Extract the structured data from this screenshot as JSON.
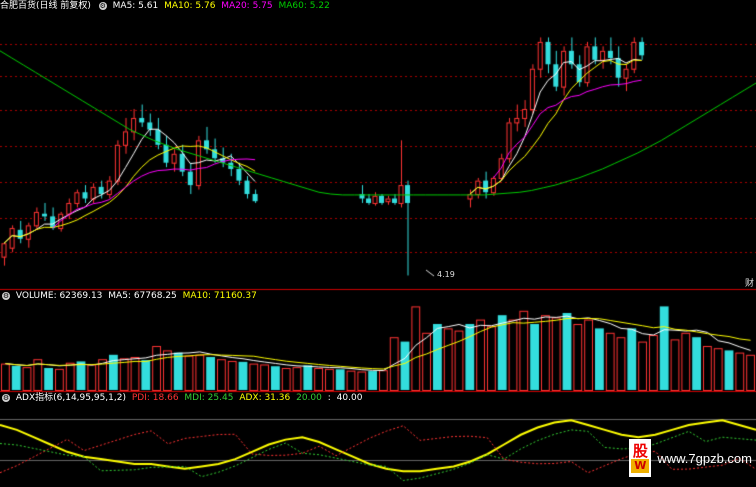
{
  "main_header": {
    "title": "合肥百货(日线 前复权)",
    "ma5": "MA5: 5.61",
    "ma10": "MA10: 5.76",
    "ma20": "MA20: 5.75",
    "ma60": "MA60: 5.22"
  },
  "volume_header": {
    "label": "VOLUME: 62369.13",
    "ma5": "MA5: 67768.25",
    "ma10": "MA10: 71160.37"
  },
  "adx_header": {
    "label": "ADX指标(6,14,95,95,1,2)",
    "pdi": "PDI: 18.66",
    "mdi": "MDI: 25.45",
    "adx": "ADX: 31.36",
    "level1": "20.00",
    "level2": "40.00"
  },
  "low_price_label": "4.19",
  "side_tag": "财",
  "watermark": {
    "logo_top": "股",
    "logo_bottom": "W",
    "site": "www.7gpzb.com"
  },
  "colors": {
    "up": "#ff3333",
    "down": "#33dddd",
    "ma5": "#ffffff",
    "ma10": "#ffff00",
    "ma20": "#ff00ff",
    "ma60": "#00cc00",
    "grid": "#aa0000",
    "adx": "#ffff00",
    "pdi": "#ff3333",
    "mdi": "#33cc33"
  },
  "chart_data": {
    "type": "candlestick",
    "y_scale": "price",
    "candles": [
      {
        "o": 4.4,
        "h": 4.55,
        "l": 4.3,
        "c": 4.55
      },
      {
        "o": 4.5,
        "h": 4.75,
        "l": 4.45,
        "c": 4.72
      },
      {
        "o": 4.7,
        "h": 4.8,
        "l": 4.55,
        "c": 4.6
      },
      {
        "o": 4.6,
        "h": 4.78,
        "l": 4.5,
        "c": 4.75
      },
      {
        "o": 4.75,
        "h": 4.95,
        "l": 4.7,
        "c": 4.9
      },
      {
        "o": 4.88,
        "h": 5.0,
        "l": 4.8,
        "c": 4.85
      },
      {
        "o": 4.85,
        "h": 4.95,
        "l": 4.7,
        "c": 4.72
      },
      {
        "o": 4.72,
        "h": 4.9,
        "l": 4.68,
        "c": 4.88
      },
      {
        "o": 4.88,
        "h": 5.05,
        "l": 4.82,
        "c": 5.0
      },
      {
        "o": 5.0,
        "h": 5.15,
        "l": 4.95,
        "c": 5.12
      },
      {
        "o": 5.12,
        "h": 5.2,
        "l": 5.0,
        "c": 5.05
      },
      {
        "o": 5.05,
        "h": 5.22,
        "l": 5.0,
        "c": 5.18
      },
      {
        "o": 5.18,
        "h": 5.25,
        "l": 5.05,
        "c": 5.1
      },
      {
        "o": 5.1,
        "h": 5.3,
        "l": 5.05,
        "c": 5.25
      },
      {
        "o": 5.25,
        "h": 5.7,
        "l": 5.2,
        "c": 5.65
      },
      {
        "o": 5.65,
        "h": 5.95,
        "l": 5.55,
        "c": 5.8
      },
      {
        "o": 5.8,
        "h": 6.05,
        "l": 5.7,
        "c": 5.95
      },
      {
        "o": 5.95,
        "h": 6.1,
        "l": 5.85,
        "c": 5.9
      },
      {
        "o": 5.9,
        "h": 6.0,
        "l": 5.75,
        "c": 5.82
      },
      {
        "o": 5.82,
        "h": 5.95,
        "l": 5.6,
        "c": 5.65
      },
      {
        "o": 5.65,
        "h": 5.75,
        "l": 5.4,
        "c": 5.45
      },
      {
        "o": 5.45,
        "h": 5.6,
        "l": 5.35,
        "c": 5.55
      },
      {
        "o": 5.55,
        "h": 5.65,
        "l": 5.3,
        "c": 5.35
      },
      {
        "o": 5.35,
        "h": 5.45,
        "l": 5.1,
        "c": 5.2
      },
      {
        "o": 5.2,
        "h": 5.75,
        "l": 5.15,
        "c": 5.7
      },
      {
        "o": 5.7,
        "h": 5.85,
        "l": 5.55,
        "c": 5.6
      },
      {
        "o": 5.6,
        "h": 5.72,
        "l": 5.45,
        "c": 5.5
      },
      {
        "o": 5.5,
        "h": 5.62,
        "l": 5.4,
        "c": 5.45
      },
      {
        "o": 5.45,
        "h": 5.55,
        "l": 5.3,
        "c": 5.38
      },
      {
        "o": 5.38,
        "h": 5.45,
        "l": 5.2,
        "c": 5.25
      },
      {
        "o": 5.25,
        "h": 5.3,
        "l": 5.05,
        "c": 5.1
      },
      {
        "o": 5.1,
        "h": 5.15,
        "l": 5.0,
        "c": 5.02
      }
    ],
    "late_candles": [
      {
        "o": 5.1,
        "h": 5.2,
        "l": 5.0,
        "c": 5.05
      },
      {
        "o": 5.05,
        "h": 5.1,
        "l": 4.98,
        "c": 5.0
      },
      {
        "o": 5.0,
        "h": 5.12,
        "l": 4.97,
        "c": 5.08
      },
      {
        "o": 5.08,
        "h": 5.1,
        "l": 4.98,
        "c": 5.0
      },
      {
        "o": 5.02,
        "h": 5.08,
        "l": 4.98,
        "c": 5.05
      },
      {
        "o": 5.05,
        "h": 5.1,
        "l": 4.98,
        "c": 5.0
      },
      {
        "o": 5.0,
        "h": 5.7,
        "l": 4.95,
        "c": 5.2
      },
      {
        "o": 5.2,
        "h": 5.25,
        "l": 4.19,
        "c": 5.0
      },
      {
        "o": 5.05,
        "h": 5.15,
        "l": 4.95,
        "c": 5.1
      },
      {
        "o": 5.1,
        "h": 5.28,
        "l": 5.05,
        "c": 5.25
      },
      {
        "o": 5.25,
        "h": 5.35,
        "l": 5.05,
        "c": 5.12
      },
      {
        "o": 5.12,
        "h": 5.3,
        "l": 5.08,
        "c": 5.28
      },
      {
        "o": 5.28,
        "h": 5.55,
        "l": 5.25,
        "c": 5.5
      },
      {
        "o": 5.5,
        "h": 5.95,
        "l": 5.45,
        "c": 5.9
      },
      {
        "o": 5.9,
        "h": 6.1,
        "l": 5.8,
        "c": 5.95
      },
      {
        "o": 5.95,
        "h": 6.15,
        "l": 5.85,
        "c": 6.05
      },
      {
        "o": 6.05,
        "h": 6.55,
        "l": 6.0,
        "c": 6.5
      },
      {
        "o": 6.5,
        "h": 6.85,
        "l": 6.4,
        "c": 6.8
      },
      {
        "o": 6.8,
        "h": 6.85,
        "l": 6.45,
        "c": 6.55
      },
      {
        "o": 6.55,
        "h": 6.7,
        "l": 6.25,
        "c": 6.3
      },
      {
        "o": 6.3,
        "h": 6.75,
        "l": 6.2,
        "c": 6.7
      },
      {
        "o": 6.7,
        "h": 6.85,
        "l": 6.5,
        "c": 6.55
      },
      {
        "o": 6.55,
        "h": 6.65,
        "l": 6.3,
        "c": 6.35
      },
      {
        "o": 6.35,
        "h": 6.8,
        "l": 6.3,
        "c": 6.75
      },
      {
        "o": 6.75,
        "h": 6.85,
        "l": 6.55,
        "c": 6.6
      },
      {
        "o": 6.6,
        "h": 6.75,
        "l": 6.5,
        "c": 6.7
      },
      {
        "o": 6.7,
        "h": 6.85,
        "l": 6.55,
        "c": 6.62
      },
      {
        "o": 6.62,
        "h": 6.75,
        "l": 6.3,
        "c": 6.4
      },
      {
        "o": 6.4,
        "h": 6.55,
        "l": 6.25,
        "c": 6.5
      },
      {
        "o": 6.5,
        "h": 6.85,
        "l": 6.45,
        "c": 6.8
      },
      {
        "o": 6.8,
        "h": 6.85,
        "l": 6.6,
        "c": 6.65
      }
    ],
    "ma60": [
      6.7,
      6.62,
      6.54,
      6.46,
      6.38,
      6.3,
      6.22,
      6.14,
      6.06,
      5.98,
      5.9,
      5.82,
      5.76,
      5.7,
      5.65,
      5.6,
      5.56,
      5.52,
      5.48,
      5.44,
      5.4,
      5.36,
      5.32,
      5.28,
      5.24,
      5.2,
      5.16,
      5.12,
      5.1,
      5.09,
      5.09,
      5.09,
      5.09,
      5.09,
      5.09,
      5.09,
      5.09,
      5.09,
      5.09,
      5.09,
      5.09,
      5.09,
      5.1,
      5.11,
      5.12,
      5.14,
      5.17,
      5.2,
      5.24,
      5.28,
      5.33,
      5.38,
      5.44,
      5.5,
      5.56,
      5.63,
      5.7,
      5.78,
      5.86,
      5.94,
      6.02,
      6.1,
      6.18,
      6.26,
      6.34
    ],
    "volume": [
      60000,
      55000,
      52000,
      70000,
      50000,
      48000,
      62000,
      65000,
      58000,
      70000,
      80000,
      72000,
      75000,
      68000,
      100000,
      90000,
      85000,
      78000,
      80000,
      75000,
      70000,
      66000,
      64000,
      60000,
      58000,
      54000,
      50000,
      52000,
      56000,
      50000,
      48000,
      47000,
      44000,
      42000,
      43000,
      45000,
      120000,
      110000,
      190000,
      130000,
      150000,
      140000,
      135000,
      150000,
      160000,
      145000,
      170000,
      160000,
      180000,
      150000,
      170000,
      165000,
      175000,
      150000,
      160000,
      140000,
      130000,
      120000,
      140000,
      110000,
      125000,
      190000,
      115000,
      130000,
      120000,
      100000,
      95000,
      90000,
      85000,
      80000
    ],
    "adx": [
      38,
      36,
      33,
      30,
      27,
      25,
      24,
      23,
      22,
      22,
      21,
      20,
      21,
      22,
      24,
      27,
      30,
      32,
      33,
      31,
      28,
      25,
      22,
      20,
      19,
      19,
      20,
      21,
      23,
      26,
      30,
      34,
      37,
      39,
      40,
      38,
      36,
      34,
      33,
      34,
      36,
      38,
      39,
      40,
      38,
      36
    ]
  }
}
